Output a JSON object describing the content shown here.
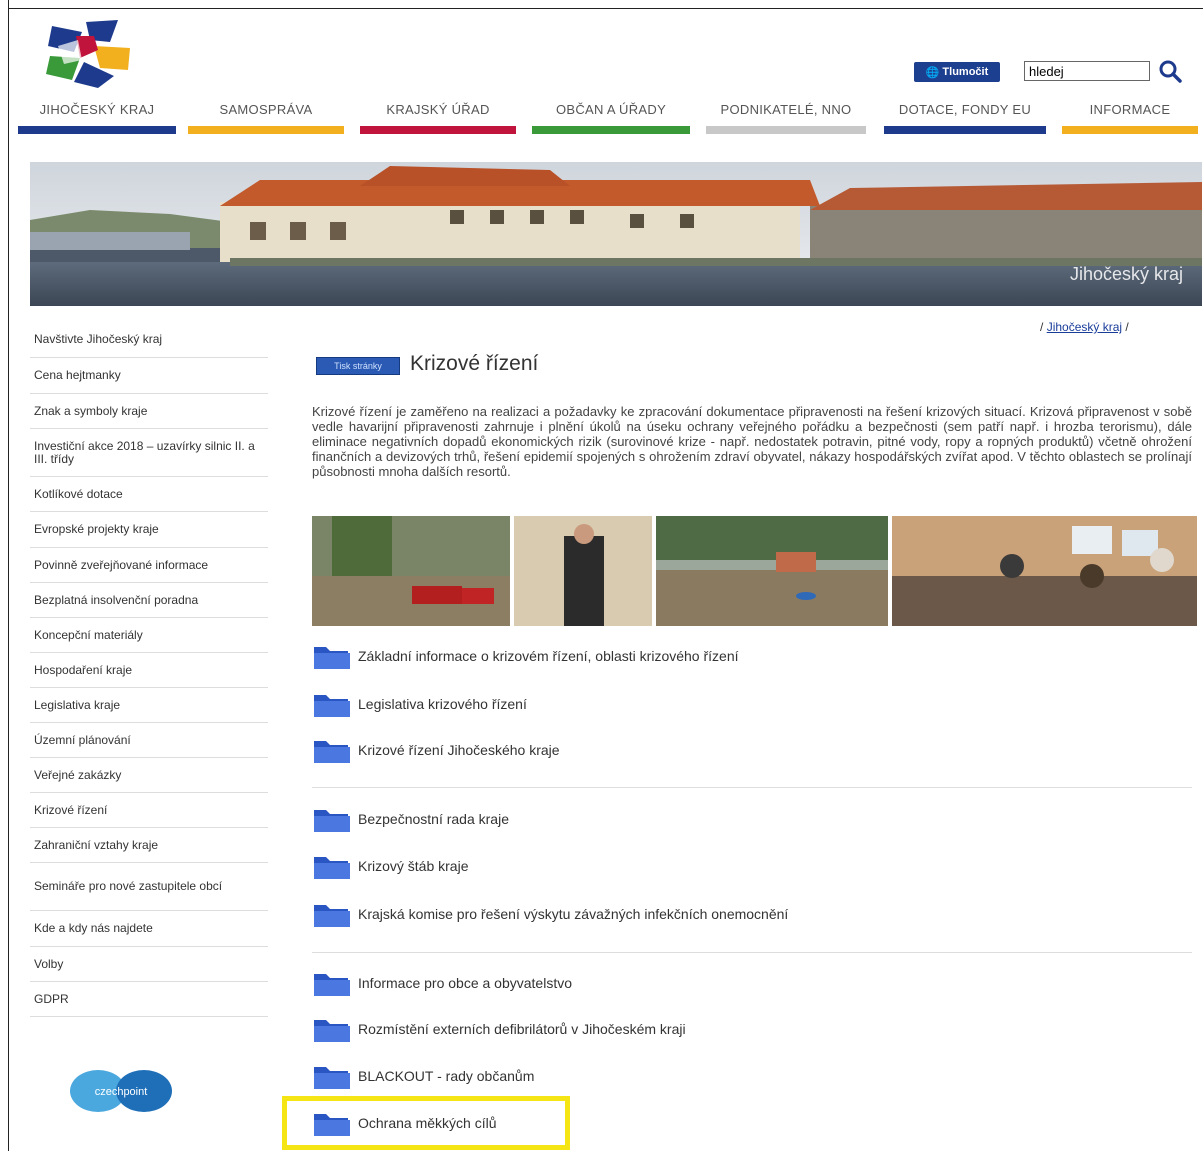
{
  "header": {
    "translate_label": "Tlumočit",
    "search_value": "hledej",
    "nav": [
      {
        "label": "Jihočeský kraj",
        "color": "#1d3a8c"
      },
      {
        "label": "Samospráva",
        "color": "#f2b01e"
      },
      {
        "label": "Krajský úřad",
        "color": "#c0143c"
      },
      {
        "label": "Občan a úřady",
        "color": "#3a9a3a"
      },
      {
        "label": "Podnikatelé, NNO",
        "color": "#c8c8c8"
      },
      {
        "label": "Dotace, fondy EU",
        "color": "#1d3a8c"
      },
      {
        "label": "Informace",
        "color": "#f2b01e"
      }
    ]
  },
  "banner": {
    "caption": "Jihočeský kraj"
  },
  "sidebar": {
    "items": [
      "Navštivte Jihočeský kraj",
      "Cena hejtmanky",
      "Znak a symboly kraje",
      "Investiční akce 2018 – uzavírky silnic II. a III. třídy",
      "Kotlíkové dotace",
      "Evropské projekty kraje",
      "Povinně zveřejňované informace",
      "Bezplatná insolvenční poradna",
      "Koncepční materiály",
      "Hospodaření kraje",
      "Legislativa kraje",
      "Územní plánování",
      "Veřejné zakázky",
      "Krizové řízení",
      "Zahraniční vztahy kraje",
      "Semináře pro nové zastupitele obcí",
      "Kde a kdy nás najdete",
      "Volby",
      "GDPR"
    ],
    "czechpoint_label": "czechpoint"
  },
  "content": {
    "breadcrumb_sep1": "/",
    "breadcrumb_link": "Jihočeský kraj",
    "breadcrumb_sep2": "/",
    "badge": "Tisk stránky",
    "title": "Krizové řízení",
    "intro": "Krizové řízení je zaměřeno na realizaci a požadavky ke zpracování dokumentace připravenosti na řešení krizových situací. Krizová připravenost v sobě vedle havarijní připravenosti zahrnuje i plnění úkolů na úseku ochrany veřejného pořádku a bezpečnosti (sem patří např. i hrozba terorismu), dále eliminace negativních dopadů ekonomických rizik (surovinové krize - např. nedostatek potravin, pitné vody, ropy a ropných produktů) včetně ohrožení finančních a devizových trhů, řešení epidemií spojených s ohrožením zdraví obyvatel, nákazy hospodářských zvířat apod. V těchto oblastech se prolínají působnosti mnoha dalších resortů.",
    "links": [
      "Základní informace o krizovém řízení, oblasti krizového řízení",
      "Legislativa krizového řízení",
      "Krizové řízení Jihočeského kraje",
      "Bezpečnostní rada kraje",
      "Krizový štáb kraje",
      "Krajská komise pro řešení výskytu závažných infekčních onemocnění",
      "Informace pro obce a obyvatelstvo",
      "Rozmístění externích defibrilátorů v Jihočeském kraji",
      "BLACKOUT - rady občanům",
      "Ochrana měkkých cílů"
    ]
  },
  "colors": {
    "highlight": "#f5e514",
    "link": "#1a3d9a"
  }
}
